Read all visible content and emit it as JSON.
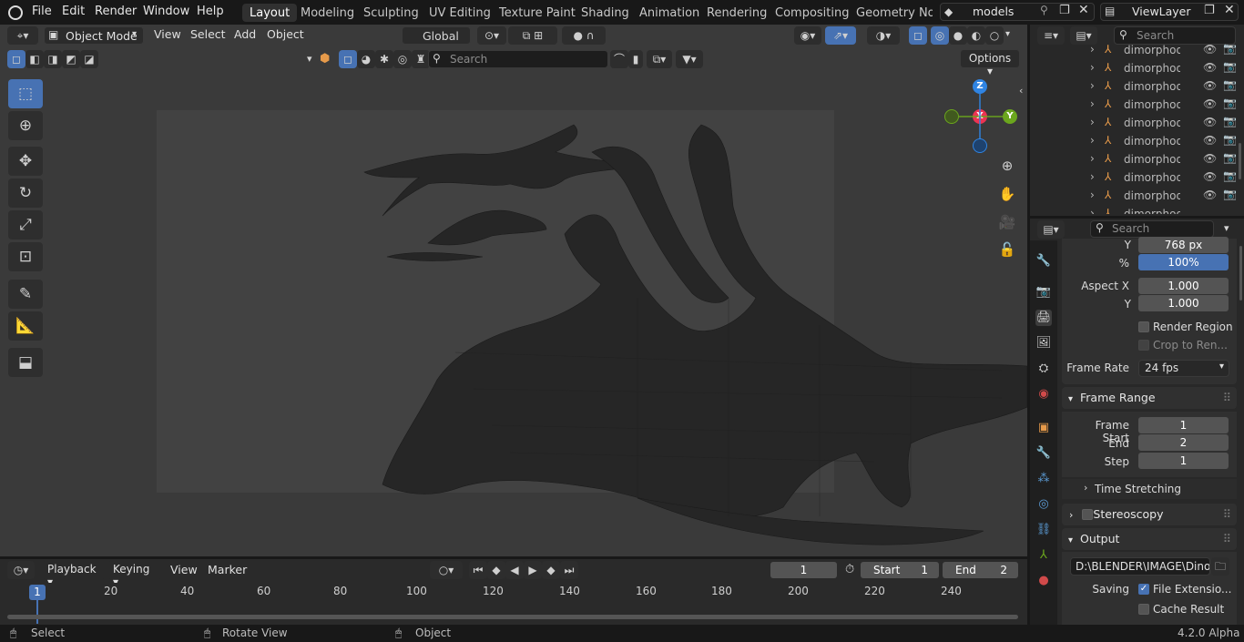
{
  "topbar": {
    "menus": [
      "File",
      "Edit",
      "Render",
      "Window",
      "Help"
    ],
    "workspaces": [
      "Layout",
      "Modeling",
      "Sculpting",
      "UV Editing",
      "Texture Paint",
      "Shading",
      "Animation",
      "Rendering",
      "Compositing",
      "Geometry Node"
    ],
    "scene_name": "models",
    "view_layer": "ViewLayer"
  },
  "viewport": {
    "mode": "Object Mode",
    "menus": [
      "View",
      "Select",
      "Add",
      "Object"
    ],
    "orientation": "Global",
    "search_placeholder": "Search",
    "options_label": "Options",
    "gizmo": {
      "z": "Z",
      "x": "X",
      "y": "Y"
    }
  },
  "outliner": {
    "search_placeholder": "Search",
    "items": [
      "dimorphodo",
      "dimorphodo",
      "dimorphodo",
      "dimorphodo",
      "dimorphodo",
      "dimorphodo",
      "dimorphodo",
      "dimorphodo",
      "dimorphodo",
      "dimorphodo"
    ]
  },
  "properties": {
    "search_placeholder": "Search",
    "res_y_label": "Y",
    "res_y": "768 px",
    "percent_label": "%",
    "percent": "100%",
    "aspect_x_label": "Aspect X",
    "aspect_x": "1.000",
    "aspect_y_label": "Y",
    "aspect_y": "1.000",
    "render_region": "Render Region",
    "crop": "Crop to Ren...",
    "frame_rate_label": "Frame Rate",
    "frame_rate": "24 fps",
    "frame_range_title": "Frame Range",
    "frame_start_label": "Frame Start",
    "frame_start": "1",
    "end_label": "End",
    "end": "2",
    "step_label": "Step",
    "step": "1",
    "time_stretching": "Time Stretching",
    "stereoscopy": "Stereoscopy",
    "output_title": "Output",
    "output_path": "D:\\BLENDER\\IMAGE\\Dino",
    "saving_label": "Saving",
    "file_ext": "File Extensio...",
    "cache_result": "Cache Result"
  },
  "timeline": {
    "menus": [
      "Playback",
      "Keying",
      "View",
      "Marker"
    ],
    "current_frame": "1",
    "start_label": "Start",
    "start": "1",
    "end_label": "End",
    "end": "2",
    "ruler": [
      "1",
      "20",
      "40",
      "60",
      "80",
      "100",
      "120",
      "140",
      "160",
      "180",
      "200",
      "220",
      "240"
    ]
  },
  "status": {
    "select": "Select",
    "rotate": "Rotate View",
    "object": "Object",
    "version": "4.2.0 Alpha"
  },
  "colors": {
    "accent": "#4772b3",
    "x": "#ed3352",
    "y": "#6ba61d",
    "z": "#2f84e3",
    "bone": "#e69a4a"
  }
}
